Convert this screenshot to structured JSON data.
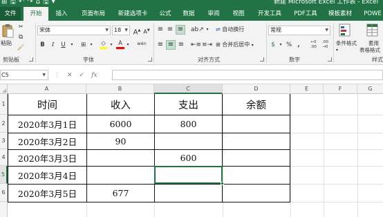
{
  "window": {
    "title": "新建 Microsoft Excel 工作表 - Excel",
    "quick_access": [
      "⊞",
      "🖫",
      "↶",
      "↷",
      "⌂",
      "🖫",
      "▾"
    ]
  },
  "ribbon": {
    "tabs": [
      {
        "label": "文件",
        "key": "file"
      },
      {
        "label": "开始",
        "key": "home",
        "active": true
      },
      {
        "label": "插入",
        "key": "insert"
      },
      {
        "label": "页面布局",
        "key": "page-layout"
      },
      {
        "label": "新建选项卡",
        "key": "new-tab"
      },
      {
        "label": "公式",
        "key": "formulas"
      },
      {
        "label": "数据",
        "key": "data"
      },
      {
        "label": "审阅",
        "key": "review"
      },
      {
        "label": "视图",
        "key": "view"
      },
      {
        "label": "开发工具",
        "key": "developer"
      },
      {
        "label": "PDF工具",
        "key": "pdf-tools"
      },
      {
        "label": "模板素材",
        "key": "templates"
      },
      {
        "label": "POWE",
        "key": "power"
      }
    ],
    "clipboard": {
      "paste_label": "粘贴",
      "group_label": "剪贴板"
    },
    "font": {
      "font_name": "宋体",
      "font_size": "18",
      "grow_label": "A",
      "shrink_label": "A",
      "bold": "B",
      "italic": "I",
      "underline": "U",
      "border_icon": "⊞",
      "fill_icon": "◇",
      "font_color_label": "A",
      "phonetic_label": "wén",
      "group_label": "字体",
      "fill_color": "#ffff00",
      "font_color": "#ff0000"
    },
    "alignment": {
      "wrap_text_label": "自动换行",
      "merge_label": "合并后居中",
      "group_label": "对齐方式"
    },
    "number": {
      "format_value": "常规",
      "currency_label": "$",
      "percent_label": "%",
      "comma_label": ",",
      "increase_decimal": "←0 .00",
      "decrease_decimal": ".00 →0",
      "group_label": "数字"
    },
    "styles": {
      "conditional_label": "条件格式",
      "table_format_label1": "套用",
      "table_format_label2": "表格格式",
      "group_label": "样式"
    }
  },
  "formula_bar": {
    "name_box": "C5",
    "cancel_icon": "✕",
    "enter_icon": "✓",
    "fx_label": "fx",
    "formula_value": ""
  },
  "sheet": {
    "columns": [
      "A",
      "B",
      "C",
      "D",
      "E",
      "F",
      "G"
    ],
    "active_column": "C",
    "rows": [
      "1",
      "2",
      "3",
      "4",
      "5",
      "6"
    ],
    "active_row": "5",
    "header_row": [
      "时间",
      "收入",
      "支出",
      "余额"
    ],
    "data": [
      [
        "2020年3月1日",
        "6000",
        "800",
        ""
      ],
      [
        "2020年3月2日",
        "90",
        "",
        ""
      ],
      [
        "2020年3月3日",
        "",
        "600",
        ""
      ],
      [
        "2020年3月4日",
        "",
        "",
        ""
      ],
      [
        "2020年3月5日",
        "677",
        "",
        ""
      ]
    ],
    "selected_cell": "C5",
    "accent_color": "#217346"
  }
}
